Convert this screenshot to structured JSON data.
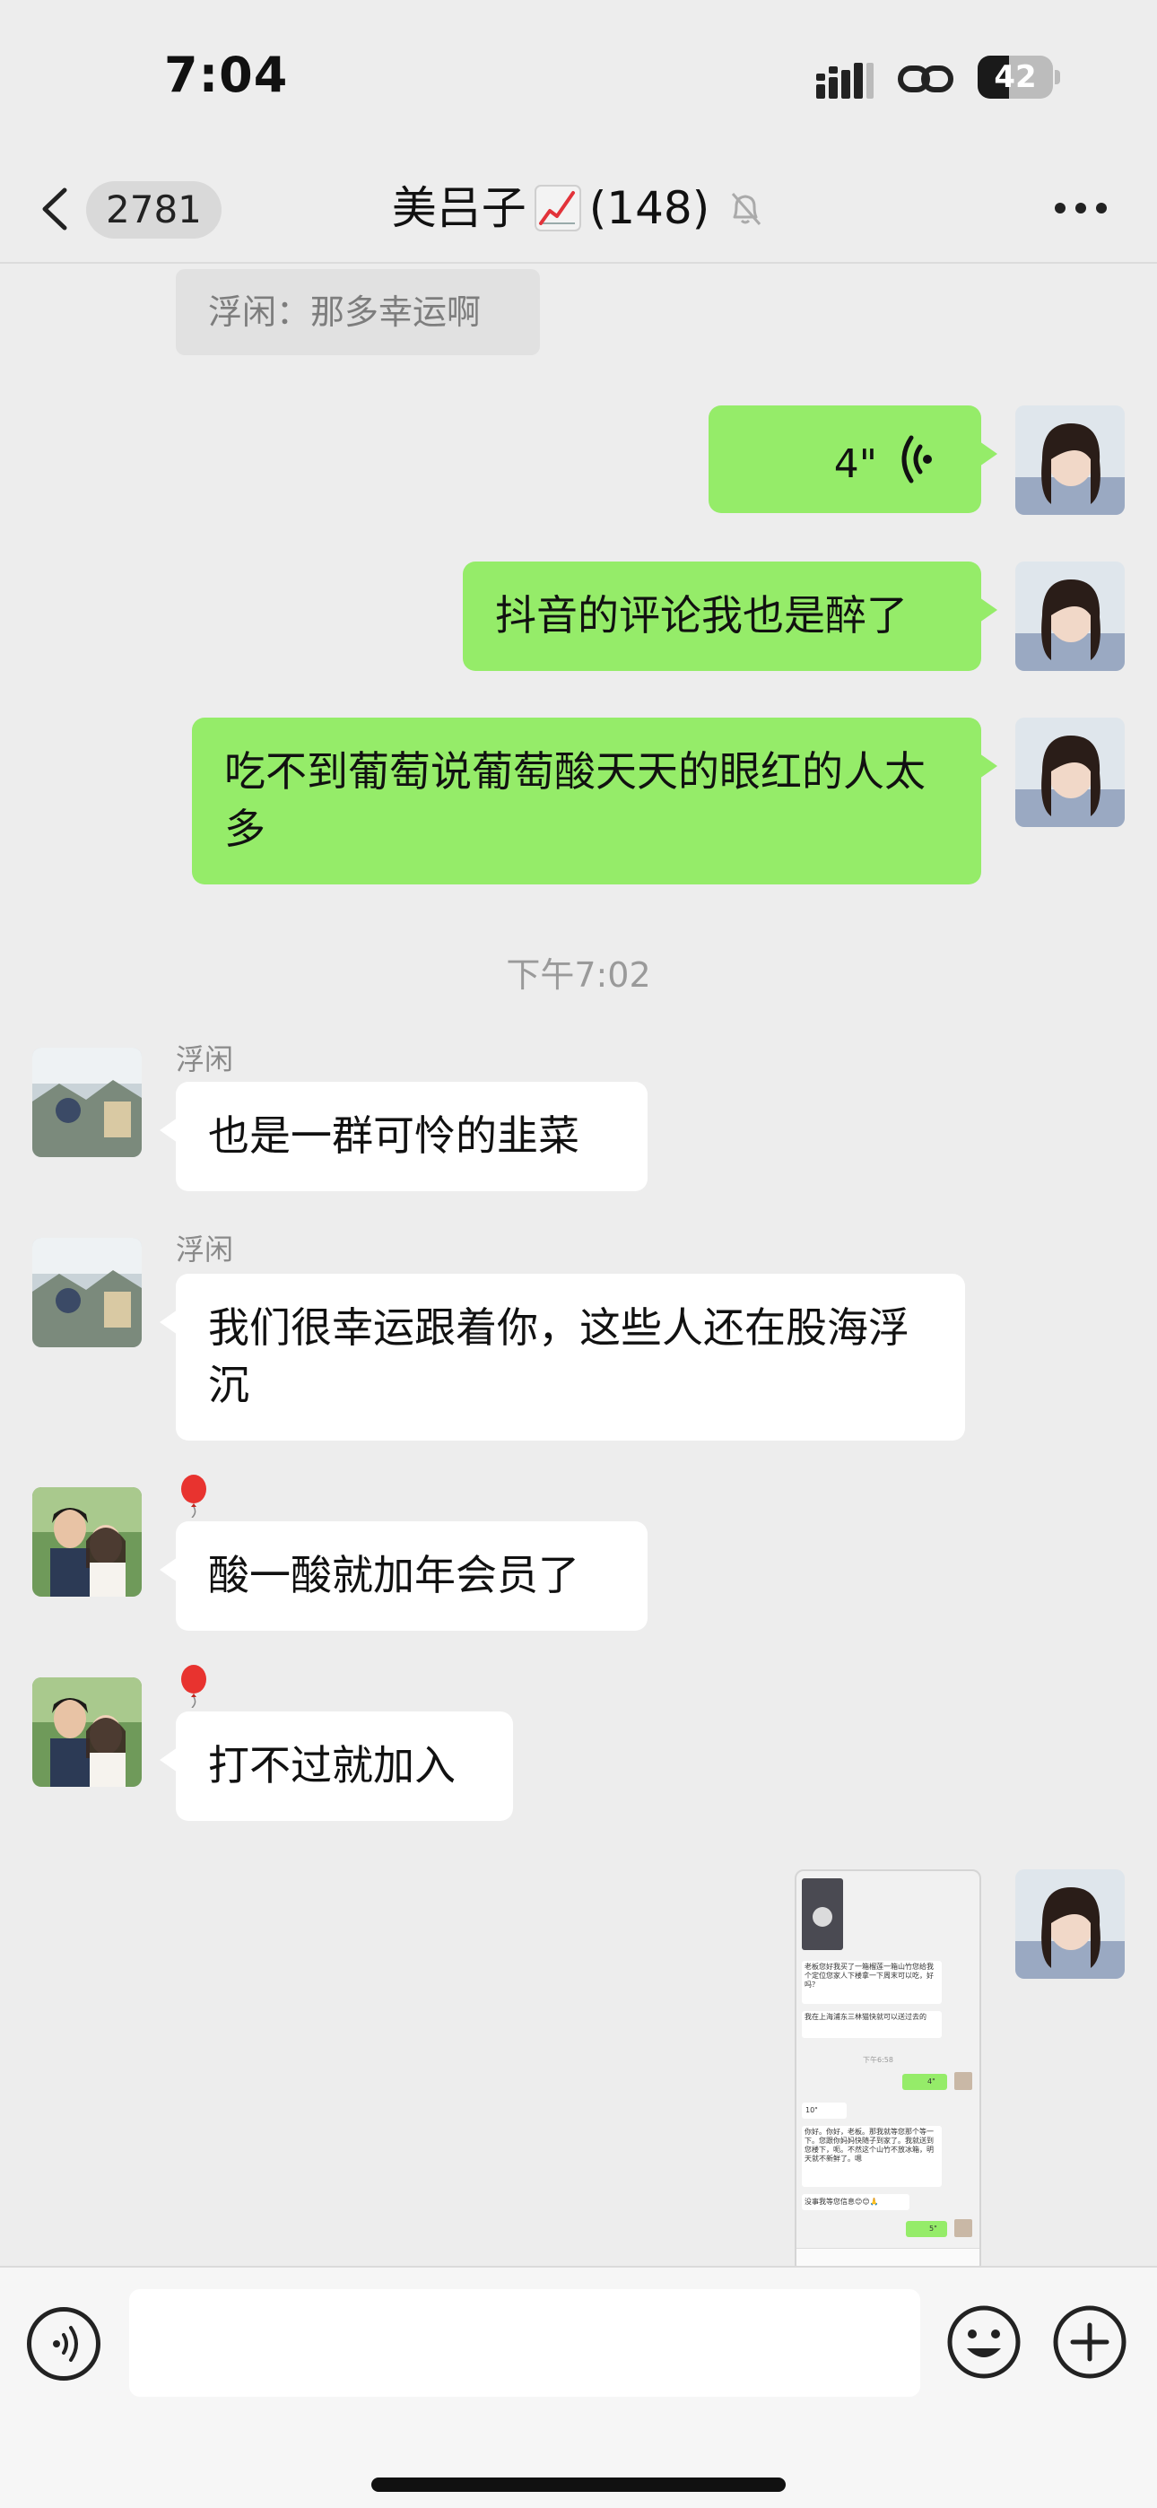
{
  "status_bar": {
    "time": "7:04",
    "battery": "42",
    "battery_level": 0.42
  },
  "nav": {
    "back_badge": "2781",
    "title": "美吕子",
    "member_count": "(148)",
    "title_icon": "chart-increasing-icon",
    "muted_icon": "bell-slash-icon",
    "more_icon": "more-dots-icon"
  },
  "chat": {
    "quoted": "浮闲：那多幸运啊",
    "voice_message": {
      "duration": "4\""
    },
    "outgoing_1": "抖音的评论我也是醉了",
    "outgoing_2": "吃不到葡萄说葡萄酸天天的眼红的人太多",
    "timestamp": "下午7:02",
    "incoming": [
      {
        "sender": "浮闲",
        "text": "也是一群可怜的韭菜"
      },
      {
        "sender": "浮闲",
        "text": "我们很幸运跟着你，这些人还在股海浮沉"
      },
      {
        "sender": "🎈",
        "text": "酸一酸就加年会员了"
      },
      {
        "sender": "🎈",
        "text": "打不过就加入"
      }
    ],
    "screenshot_thumb": {
      "text_1": "老板您好我买了一箱榴莲一箱山竹您给我个定位您家人下楼拿一下周末可以吃，好吗？",
      "text_2": "我在上海浦东三林猫快就可以送过去的",
      "text_3": "下午6:58",
      "text_4": "4\"",
      "text_5": "10\"",
      "text_6": "你好。你好，老板。那我就等您那个等一下。您跟你妈妈快随子到家了。我就送到您楼下，呃。不然这个山竹不放冰箱，明天就不新鲜了。嗯",
      "text_7": "没事我等您信息😊😊🙏",
      "text_8": "5\""
    }
  },
  "input_bar": {
    "placeholder": ""
  },
  "colors": {
    "outgoing_bubble": "#95ec69",
    "incoming_bubble": "#ffffff",
    "background": "#ededed"
  }
}
